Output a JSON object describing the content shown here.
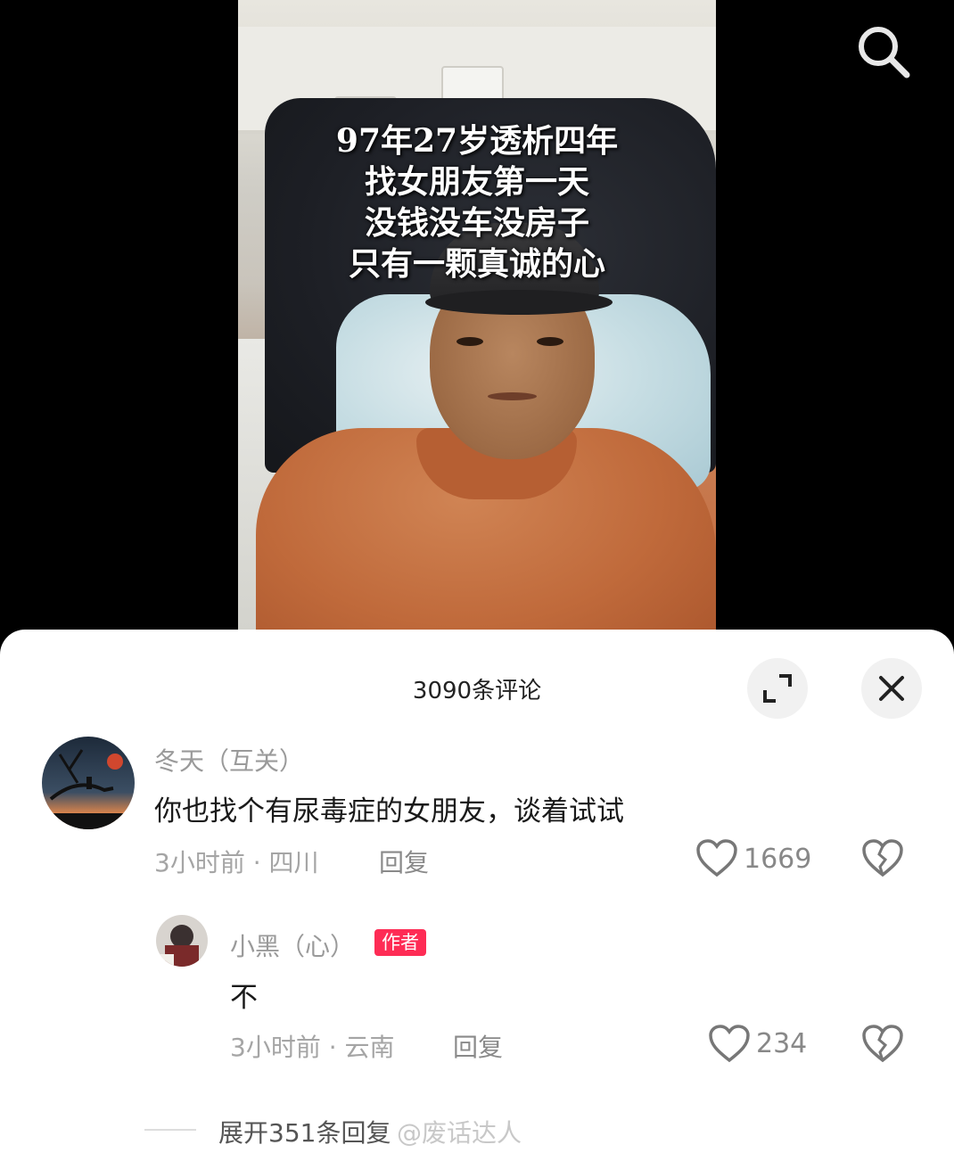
{
  "video": {
    "overlay_lines": [
      "97年27岁透析四年",
      "找女朋友第一天",
      "没钱没车没房子",
      "只有一颗真诚的心"
    ]
  },
  "comments_panel": {
    "title": "3090条评论",
    "comments": [
      {
        "username": "冬天（互关）",
        "text": "你也找个有尿毒症的女朋友，谈着试试",
        "time": "3小时前",
        "location": "四川",
        "reply_label": "回复",
        "likes": "1669"
      },
      {
        "username": "小黑（心）",
        "badge": "作者",
        "text": "不",
        "time": "3小时前",
        "location": "云南",
        "reply_label": "回复",
        "likes": "234"
      }
    ],
    "expand_replies": "展开351条回复",
    "watermark": "@废话达人"
  },
  "colors": {
    "author_badge": "#fe2c55",
    "panel_bg": "#ffffff"
  }
}
